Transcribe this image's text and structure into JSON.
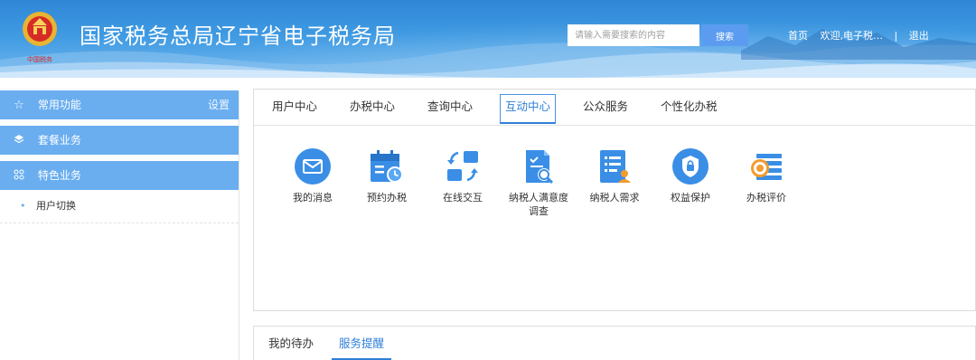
{
  "header": {
    "title": "国家税务总局辽宁省电子税务局",
    "emblem_caption": "中国税务",
    "search": {
      "placeholder": "请输入需要搜索的内容",
      "button_label": "搜索"
    },
    "links": {
      "home": "首页",
      "welcome": "欢迎,电子税…",
      "separator": "|",
      "logout": "退出"
    }
  },
  "sidebar": {
    "sections": [
      {
        "icon": "star-icon",
        "label": "常用功能",
        "settings_label": "设置"
      },
      {
        "icon": "layers-icon",
        "label": "套餐业务"
      },
      {
        "icon": "grid-icon",
        "label": "特色业务"
      }
    ],
    "sub_items": [
      {
        "label": "用户切换"
      }
    ]
  },
  "main": {
    "tabs": [
      {
        "label": "用户中心"
      },
      {
        "label": "办税中心"
      },
      {
        "label": "查询中心"
      },
      {
        "label": "互动中心",
        "active": true
      },
      {
        "label": "公众服务"
      },
      {
        "label": "个性化办税"
      }
    ],
    "services": [
      {
        "icon": "message-icon",
        "label": "我的消息"
      },
      {
        "icon": "appointment-calendar-icon",
        "label": "预约办税"
      },
      {
        "icon": "online-interaction-icon",
        "label": "在线交互"
      },
      {
        "icon": "satisfaction-survey-icon",
        "label": "纳税人满意度调查"
      },
      {
        "icon": "taxpayer-needs-icon",
        "label": "纳税人需求"
      },
      {
        "icon": "rights-protection-shield-icon",
        "label": "权益保护"
      },
      {
        "icon": "tax-evaluation-icon",
        "label": "办税评价"
      }
    ]
  },
  "bottom_tabs": [
    {
      "label": "我的待办"
    },
    {
      "label": "服务提醒",
      "active": true
    }
  ],
  "colors": {
    "accent": "#2f7fd8",
    "sidebar": "#6aaef0",
    "header": "#3f9ae2",
    "icon_blue": "#3a8ee6"
  }
}
